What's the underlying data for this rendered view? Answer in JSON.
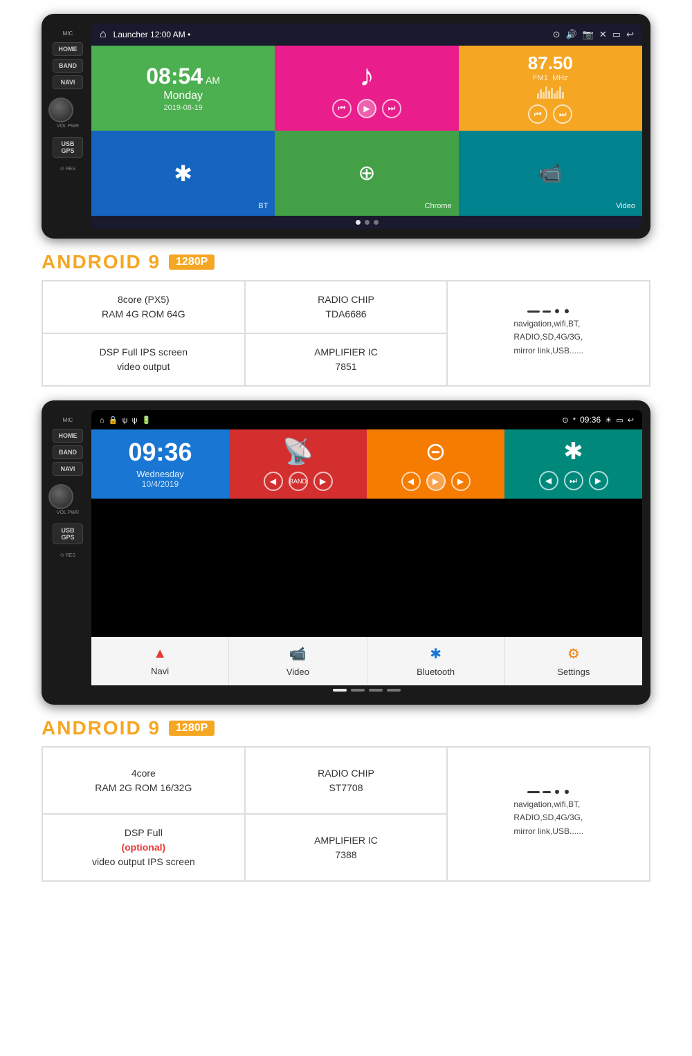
{
  "device1": {
    "status_bar": {
      "home_icon": "⌂",
      "launcher": "Launcher  12:00 AM  •",
      "icons": [
        "⊙",
        "🔊",
        "📷",
        "✕",
        "▭",
        "↩"
      ]
    },
    "tile1": {
      "time": "08:54",
      "am_pm": "AM",
      "day": "Monday",
      "date": "2019-08-19"
    },
    "tile2": {
      "icon": "♪"
    },
    "tile3": {
      "freq": "87.50",
      "label": "FM1",
      "mhz": "MHz"
    },
    "tile4": {
      "icon": "✱",
      "label": "BT"
    },
    "tile5": {
      "icon": "⊕",
      "label": "Chrome"
    },
    "tile6": {
      "icon": "📹",
      "label": "Video"
    },
    "dots": [
      "active",
      "",
      ""
    ]
  },
  "device2": {
    "status_bar": {
      "icons_left": "🔒 ψ ψ 🔋",
      "time": "09:36",
      "icons_right": "⊙ * ☀ ▭ ↩"
    },
    "tile1": {
      "time": "09:36",
      "day": "Wednesday",
      "date": "10/4/2019"
    },
    "tile4_label": "BT",
    "dots": [
      "active",
      "",
      "",
      ""
    ]
  },
  "section1": {
    "android_title": "ANDROID 9",
    "resolution": "1280P",
    "specs": [
      {
        "id": "cpu",
        "line1": "8core   (PX5)",
        "line2": "RAM 4G ROM 64G"
      },
      {
        "id": "radio",
        "line1": "RADIO  CHIP",
        "line2": "TDA6686"
      },
      {
        "id": "features",
        "text": "navigation,wifi,BT,\nRADIO,SD,4G/3G,\nmirror link,USB......"
      },
      {
        "id": "display",
        "line1": "DSP Full IPS screen",
        "line2": "video output"
      },
      {
        "id": "amplifier",
        "line1": "AMPLIFIER IC",
        "line2": "7851"
      }
    ]
  },
  "section2": {
    "android_title": "ANDROID 9",
    "resolution": "1280P",
    "specs": [
      {
        "id": "cpu",
        "line1": "4core",
        "line2": "RAM 2G  ROM 16/32G"
      },
      {
        "id": "radio",
        "line1": "RADIO  CHIP",
        "line2": "ST7708"
      },
      {
        "id": "features",
        "text": "navigation,wifi,BT,\nRADIO,SD,4G/3G,\nmirror link,USB......"
      },
      {
        "id": "display",
        "line1": "DSP Full",
        "line2_optional": "(optional)",
        "line3": "video output IPS screen"
      },
      {
        "id": "amplifier",
        "line1": "AMPLIFIER IC",
        "line2": "7388"
      }
    ]
  },
  "nav_items": {
    "navi": "Navi",
    "video": "Video",
    "bluetooth": "Bluetooth",
    "settings": "Settings"
  }
}
